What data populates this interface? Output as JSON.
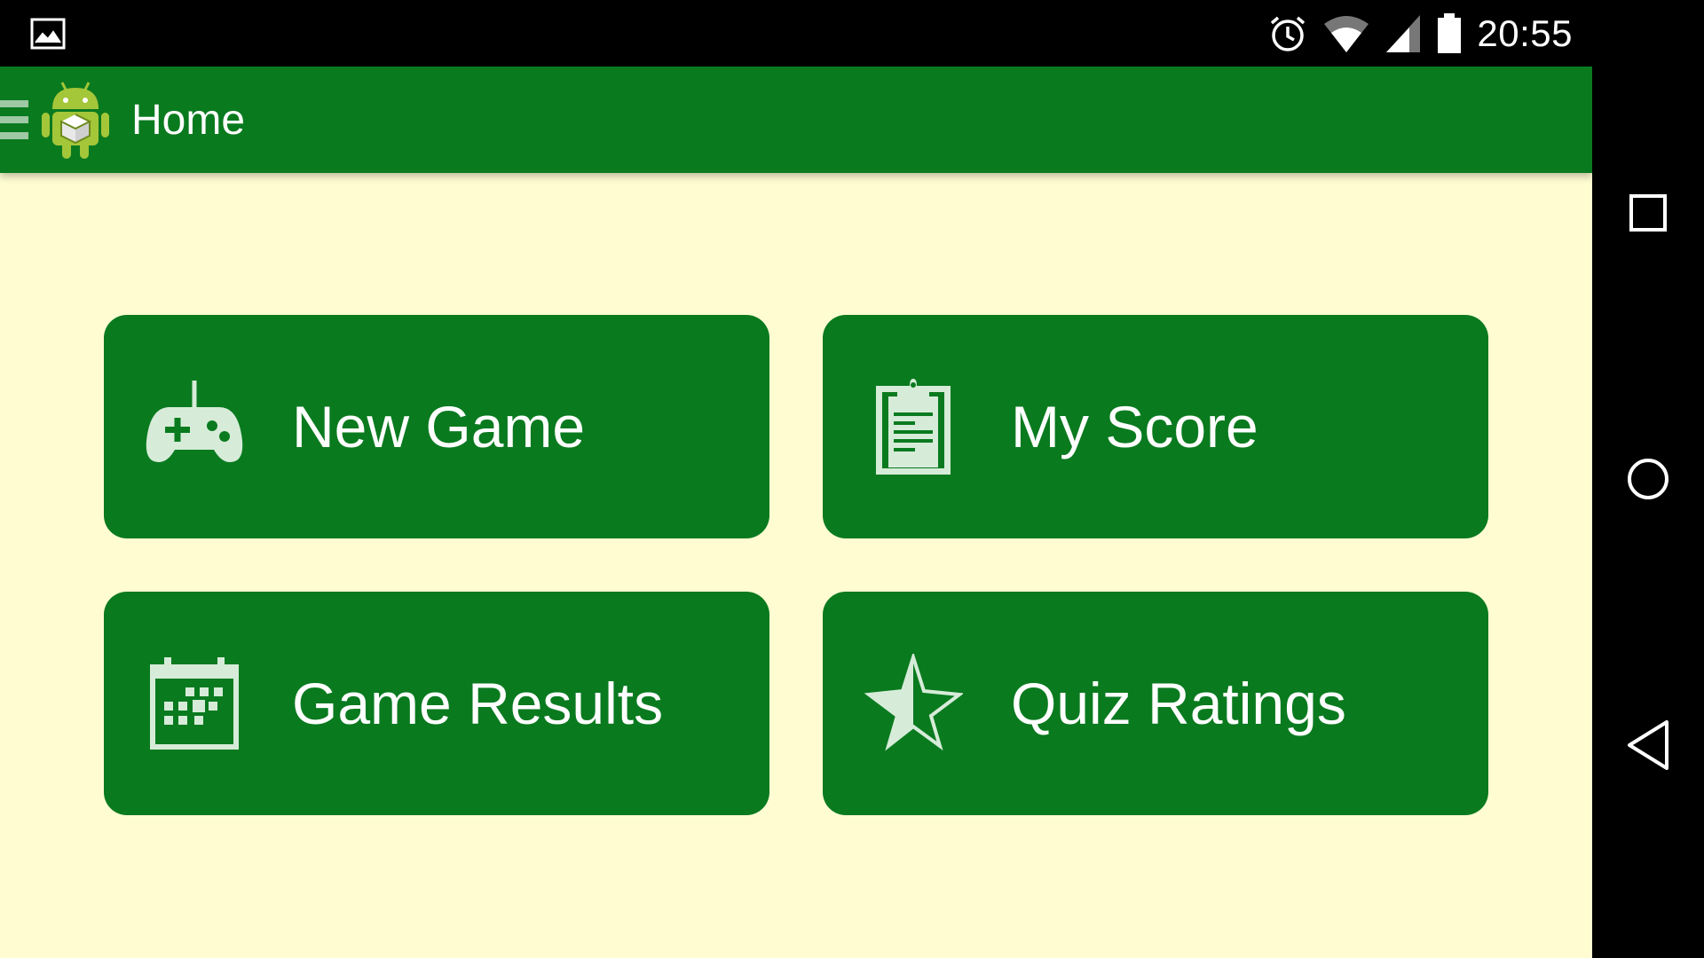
{
  "status_bar": {
    "time": "20:55",
    "icons": [
      "gallery-icon",
      "alarm-icon",
      "wifi-icon",
      "cell-signal-icon",
      "battery-icon"
    ]
  },
  "toolbar": {
    "title": "Home",
    "icons": [
      "hamburger-icon",
      "android-logo-icon"
    ],
    "color": "#0a7a1f"
  },
  "tiles": [
    {
      "label": "New Game",
      "icon": "gamepad-icon"
    },
    {
      "label": "My Score",
      "icon": "clipboard-icon"
    },
    {
      "label": "Game Results",
      "icon": "calendar-icon"
    },
    {
      "label": "Quiz Ratings",
      "icon": "star-icon"
    }
  ],
  "nav_bar": {
    "icons": [
      "recents-square-icon",
      "home-circle-icon",
      "back-triangle-icon"
    ]
  },
  "colors": {
    "app_background": "#fffcd2",
    "primary_green": "#0a7a1f",
    "icon_tint": "#d6ecd9",
    "status_bar": "#000000"
  }
}
